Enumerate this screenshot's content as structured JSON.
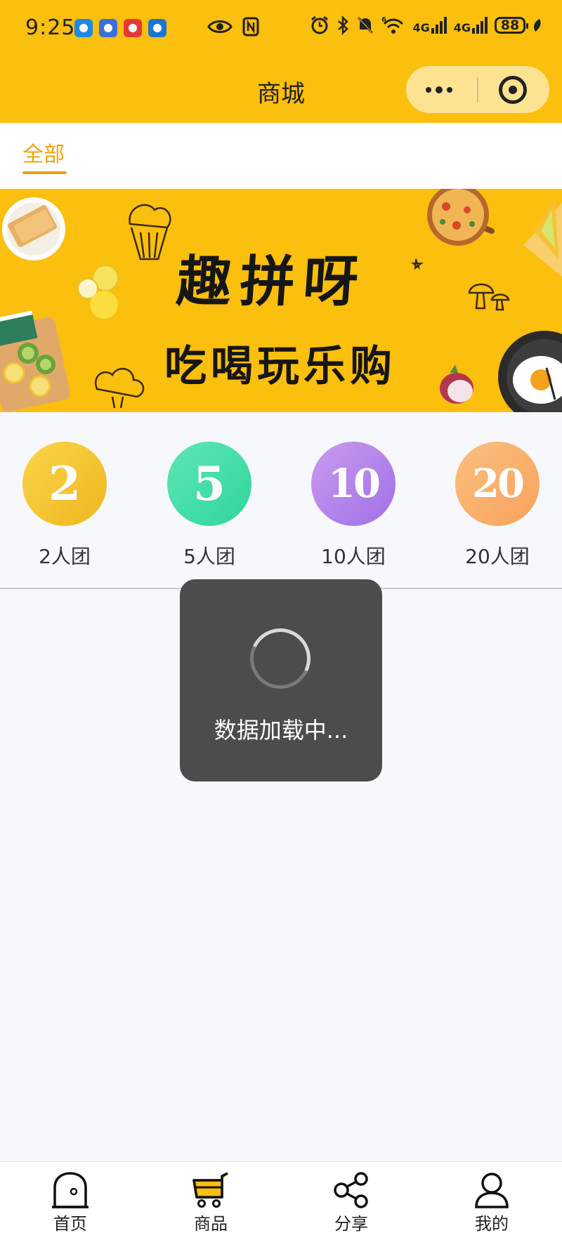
{
  "status_bar": {
    "time": "9:25",
    "battery": "88",
    "signal_1": "4G",
    "signal_2": "4G",
    "wifi_badge": "6",
    "app_icons": [
      {
        "name": "messages-app-icon",
        "color": "#1e88e5"
      },
      {
        "name": "browser-app-icon",
        "color": "#3a6fd8"
      },
      {
        "name": "notes-app-icon",
        "color": "#e53935"
      },
      {
        "name": "tips-app-icon",
        "color": "#1976d2"
      }
    ]
  },
  "nav": {
    "title": "商城"
  },
  "tabs": {
    "active": "全部"
  },
  "banner": {
    "title": "趣拼呀",
    "subtitle": "吃喝玩乐购"
  },
  "groups": [
    {
      "number": "2",
      "label": "2人团",
      "color_from": "#f9d54a",
      "color_to": "#f0b61e"
    },
    {
      "number": "5",
      "label": "5人团",
      "color_from": "#5ee6b5",
      "color_to": "#2fd69c"
    },
    {
      "number": "10",
      "label": "10人团",
      "color_from": "#c99bf0",
      "color_to": "#a070e6"
    },
    {
      "number": "20",
      "label": "20人团",
      "color_from": "#fcbf80",
      "color_to": "#f7a25c"
    }
  ],
  "toast": {
    "text": "数据加载中..."
  },
  "bottom_nav": [
    {
      "label": "首页",
      "icon": "home-icon"
    },
    {
      "label": "商品",
      "icon": "cart-icon"
    },
    {
      "label": "分享",
      "icon": "share-icon"
    },
    {
      "label": "我的",
      "icon": "user-icon"
    }
  ],
  "colors": {
    "brand": "#fbbf0e",
    "active_tab": "#f0a20a",
    "page_bg": "#f7f8fb"
  }
}
